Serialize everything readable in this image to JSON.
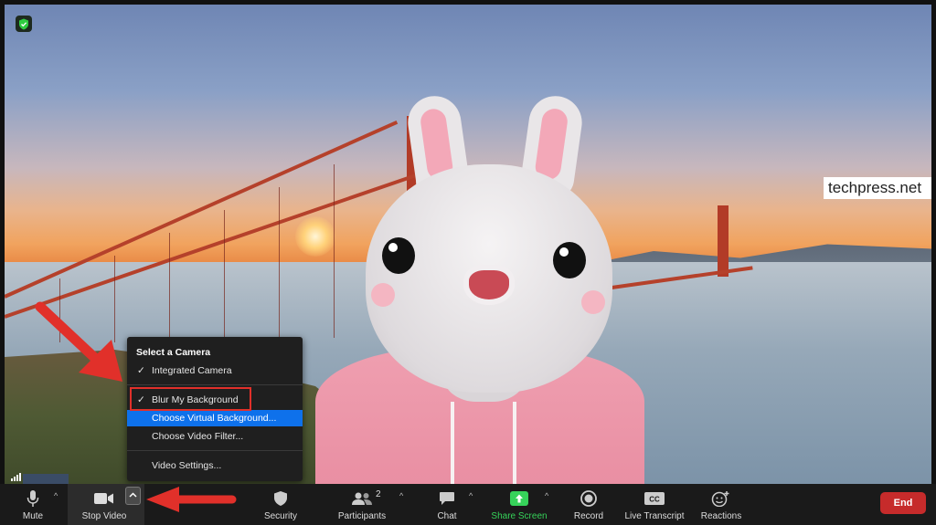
{
  "watermark": "techpress.net",
  "camera_menu": {
    "header": "Select a Camera",
    "items": [
      {
        "label": "Integrated Camera",
        "checked": true
      },
      {
        "label": "Blur My Background",
        "checked": true
      },
      {
        "label": "Choose Virtual Background...",
        "checked": false,
        "selected": true
      },
      {
        "label": "Choose Video Filter...",
        "checked": false
      },
      {
        "label": "Video Settings...",
        "checked": false
      }
    ]
  },
  "toolbar": {
    "mute": "Mute",
    "stop_video": "Stop Video",
    "security": "Security",
    "participants": "Participants",
    "participants_count": "2",
    "chat": "Chat",
    "share_screen": "Share Screen",
    "record": "Record",
    "live_transcript": "Live Transcript",
    "reactions": "Reactions",
    "end": "End"
  },
  "colors": {
    "share_green": "#36d35a",
    "end_red": "#c62b2b",
    "menu_selected": "#0e71eb",
    "annotation_red": "#e1302a"
  }
}
